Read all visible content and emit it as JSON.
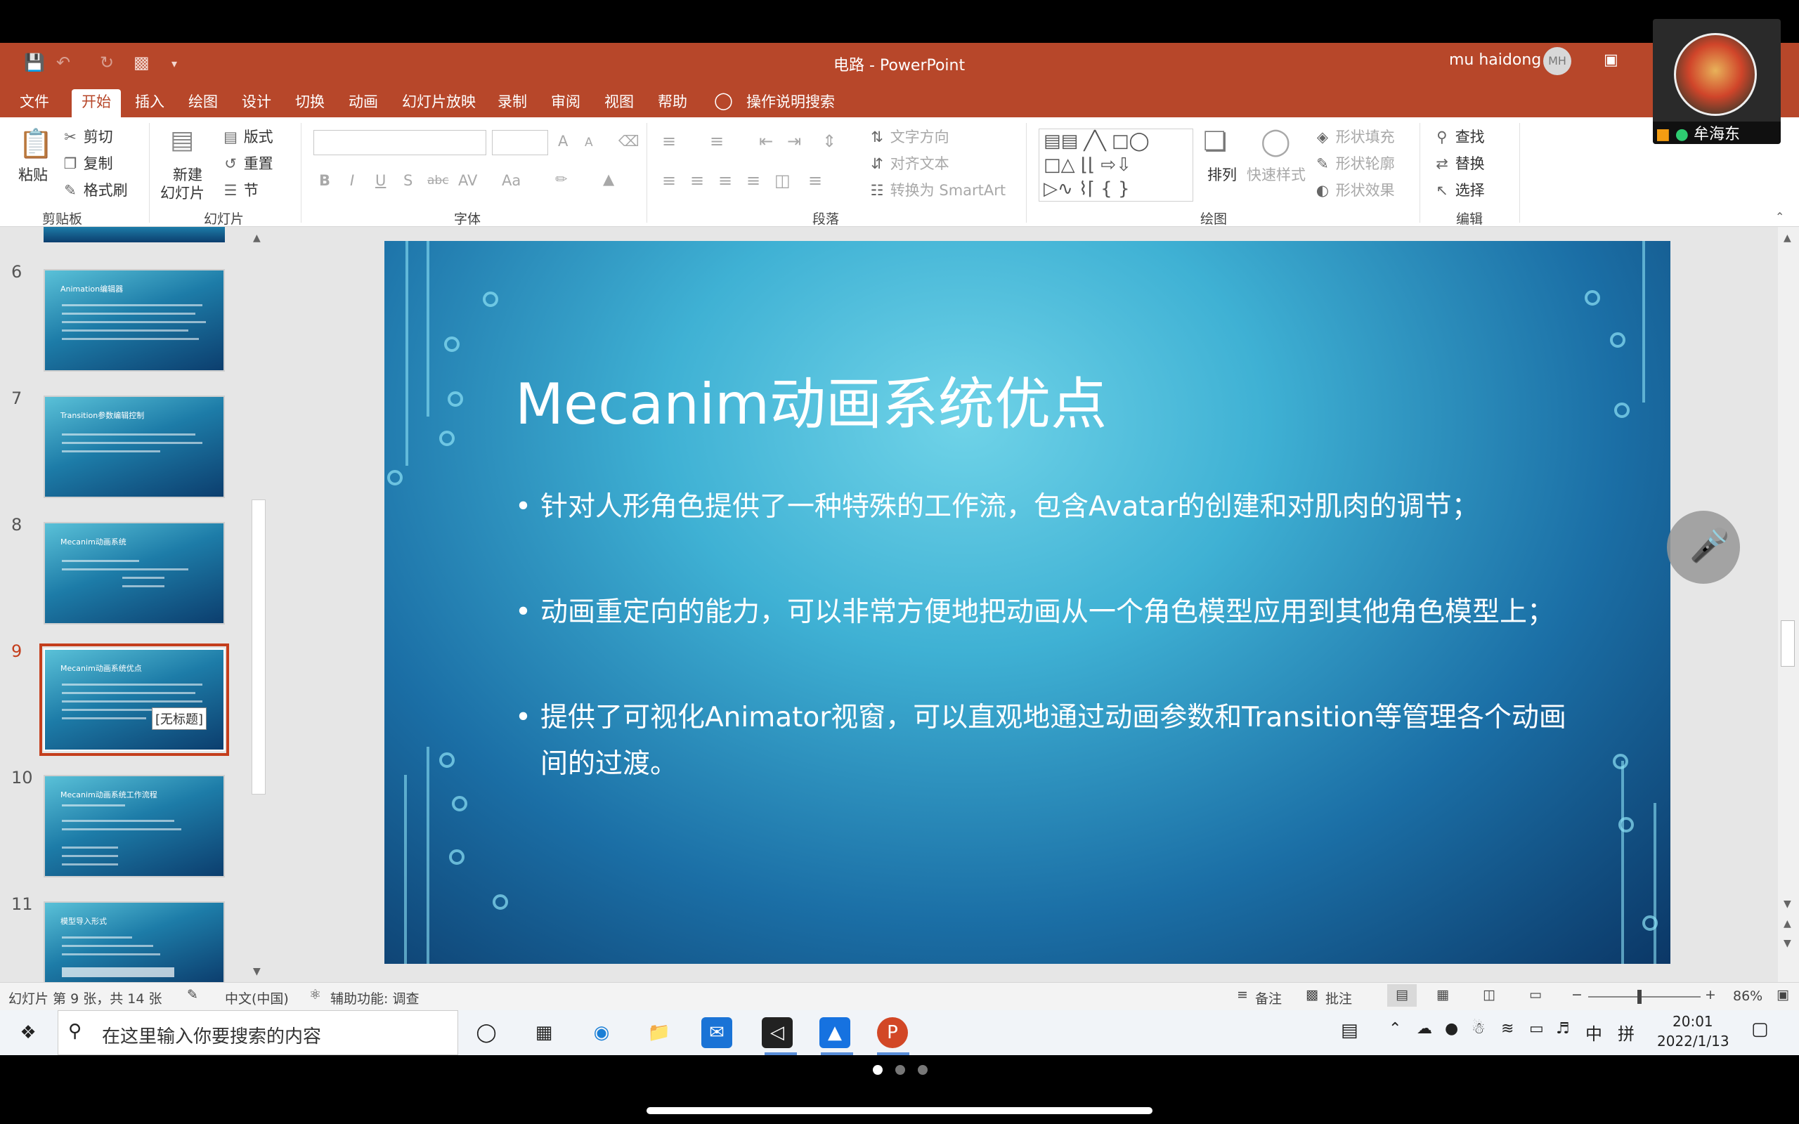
{
  "window": {
    "doc_name": "电路",
    "separator": "-",
    "app_name": "PowerPoint",
    "user_name": "mu haidong",
    "user_initials": "MH"
  },
  "tabs": [
    "文件",
    "开始",
    "插入",
    "绘图",
    "设计",
    "切换",
    "动画",
    "幻灯片放映",
    "录制",
    "审阅",
    "视图",
    "帮助"
  ],
  "tell_me": "操作说明搜索",
  "ribbon": {
    "clipboard": {
      "paste": "粘贴",
      "cut": "剪切",
      "copy": "复制",
      "format_painter": "格式刷",
      "group": "剪贴板"
    },
    "slides": {
      "new_slide_1": "新建",
      "new_slide_2": "幻灯片",
      "layout": "版式",
      "reset": "重置",
      "section": "节",
      "group": "幻灯片"
    },
    "font": {
      "group": "字体",
      "bold": "B",
      "italic": "I",
      "underline": "U",
      "shadow": "S",
      "strike": "abc",
      "spacing": "AV",
      "case": "Aa",
      "grow": "A",
      "shrink": "A"
    },
    "paragraph": {
      "group": "段落",
      "text_direction": "文字方向",
      "align_text": "对齐文本",
      "smartart": "转换为 SmartArt"
    },
    "drawing": {
      "arrange": "排列",
      "quick_styles": "快速样式",
      "fill": "形状填充",
      "outline": "形状轮廓",
      "effects": "形状效果",
      "group": "绘图"
    },
    "editing": {
      "find": "查找",
      "replace": "替换",
      "select": "选择",
      "group": "编辑"
    }
  },
  "thumbnails": [
    {
      "num": "6",
      "title": "Animation编辑器"
    },
    {
      "num": "7",
      "title": "Transition参数编辑控制"
    },
    {
      "num": "8",
      "title": "Mecanim动画系统"
    },
    {
      "num": "9",
      "title": "Mecanim动画系统优点",
      "tooltip": "[无标题]"
    },
    {
      "num": "10",
      "title": "Mecanim动画系统工作流程"
    },
    {
      "num": "11",
      "title": "模型导入形式"
    }
  ],
  "slide": {
    "title": "Mecanim动画系统优点",
    "bullets": [
      "针对人形角色提供了一种特殊的工作流，包含Avatar的创建和对肌肉的调节；",
      "动画重定向的能力，可以非常方便地把动画从一个角色模型应用到其他角色模型上；",
      "提供了可视化Animator视窗，可以直观地通过动画参数和Transition等管理各个动画间的过渡。"
    ]
  },
  "status": {
    "slide_info": "幻灯片 第 9 张，共 14 张",
    "language": "中文(中国)",
    "accessibility": "辅助功能: 调查",
    "notes": "备注",
    "comments": "批注",
    "zoom": "86%",
    "zoom_minus": "−",
    "zoom_plus": "+"
  },
  "taskbar": {
    "search_placeholder": "在这里输入你要搜索的内容",
    "time": "20:01",
    "date": "2022/1/13",
    "ime_lang": "中",
    "ime_mode": "拼"
  },
  "video": {
    "participant": "牟海东"
  },
  "colors": {
    "accent": "#b7472a",
    "selection": "#c43e1c"
  }
}
